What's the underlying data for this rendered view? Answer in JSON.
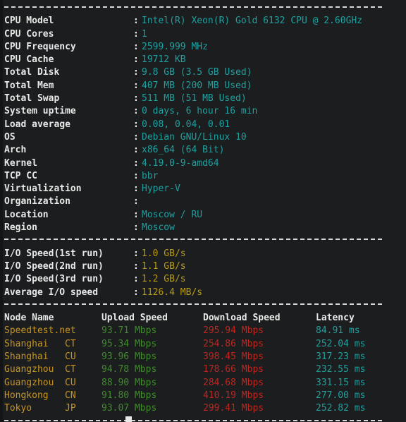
{
  "terminal": {
    "background": "#1b1d1e",
    "gutter_color": "#121415",
    "colors": {
      "label": "#e8e8e8",
      "value_cyan": "#1fa0a0",
      "io_yellow": "#b89b14",
      "node_amber": "#c9951f",
      "upload_green": "#3f8b2c",
      "download_red": "#c1251d",
      "latency_cyan": "#1fa0a0",
      "rule_dash": "#d8d8d8"
    },
    "separator": "------------------------------------------------------",
    "colon": ":"
  },
  "system_info": {
    "rows": [
      {
        "label": "CPU Model",
        "value": "Intel(R) Xeon(R) Gold 6132 CPU @ 2.60GHz"
      },
      {
        "label": "CPU Cores",
        "value": "1"
      },
      {
        "label": "CPU Frequency",
        "value": "2599.999 MHz"
      },
      {
        "label": "CPU Cache",
        "value": "19712 KB"
      },
      {
        "label": "Total Disk",
        "value": "9.8 GB (3.5 GB Used)"
      },
      {
        "label": "Total Mem",
        "value": "407 MB (200 MB Used)"
      },
      {
        "label": "Total Swap",
        "value": "511 MB (51 MB Used)"
      },
      {
        "label": "System uptime",
        "value": "0 days, 6 hour 16 min"
      },
      {
        "label": "Load average",
        "value": "0.08, 0.04, 0.01"
      },
      {
        "label": "OS",
        "value": "Debian GNU/Linux 10"
      },
      {
        "label": "Arch",
        "value": "x86_64 (64 Bit)"
      },
      {
        "label": "Kernel",
        "value": "4.19.0-9-amd64"
      },
      {
        "label": "TCP CC",
        "value": "bbr"
      },
      {
        "label": "Virtualization",
        "value": "Hyper-V"
      },
      {
        "label": "Organization",
        "value": ""
      },
      {
        "label": "Location",
        "value": "Moscow / RU"
      },
      {
        "label": "Region",
        "value": "Moscow"
      }
    ]
  },
  "io_speed": {
    "rows": [
      {
        "label": "I/O Speed(1st run)",
        "value": "1.0 GB/s"
      },
      {
        "label": "I/O Speed(2nd run)",
        "value": "1.1 GB/s"
      },
      {
        "label": "I/O Speed(3rd run)",
        "value": "1.2 GB/s"
      },
      {
        "label": "Average I/O speed",
        "value": "1126.4 MB/s"
      }
    ]
  },
  "speedtest": {
    "headers": {
      "node": "Node Name",
      "cc": "",
      "upload": "Upload Speed",
      "download": "Download Speed",
      "latency": "Latency"
    },
    "rows": [
      {
        "node": "Speedtest.net",
        "cc": "",
        "upload": "93.71 Mbps",
        "download": "295.94 Mbps",
        "latency": "84.91 ms"
      },
      {
        "node": "Shanghai",
        "cc": "CT",
        "upload": "95.34 Mbps",
        "download": "254.86 Mbps",
        "latency": "252.04 ms"
      },
      {
        "node": "Shanghai",
        "cc": "CU",
        "upload": "93.96 Mbps",
        "download": "398.45 Mbps",
        "latency": "317.23 ms"
      },
      {
        "node": "Guangzhou",
        "cc": "CT",
        "upload": "94.78 Mbps",
        "download": "178.66 Mbps",
        "latency": "232.55 ms"
      },
      {
        "node": "Guangzhou",
        "cc": "CU",
        "upload": "88.90 Mbps",
        "download": "284.68 Mbps",
        "latency": "331.15 ms"
      },
      {
        "node": "Hongkong",
        "cc": "CN",
        "upload": "91.80 Mbps",
        "download": "410.19 Mbps",
        "latency": "277.00 ms"
      },
      {
        "node": "Tokyo",
        "cc": "JP",
        "upload": "93.07 Mbps",
        "download": "299.41 Mbps",
        "latency": "252.82 ms"
      }
    ]
  }
}
